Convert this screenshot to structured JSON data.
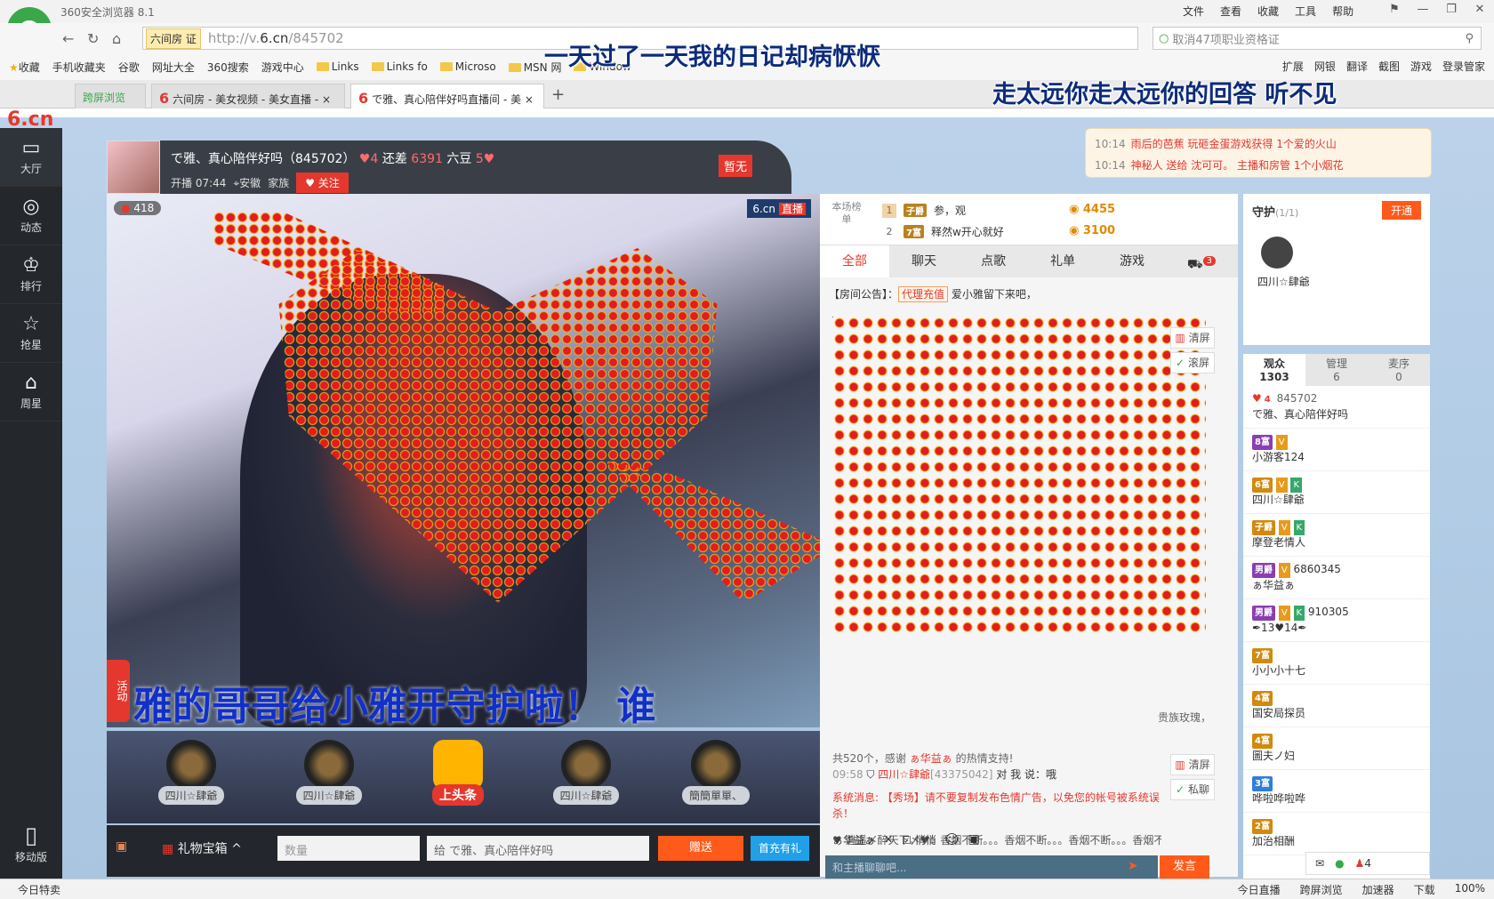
{
  "browser": {
    "title": "360安全浏览器 8.1",
    "menu": [
      "文件",
      "查看",
      "收藏",
      "工具",
      "帮助"
    ],
    "window_controls": [
      "⚑",
      "—",
      "❐",
      "✕"
    ],
    "zone_label": "六间房",
    "zone_badge": "证",
    "url_prefix": "http://v.",
    "url_host": "6.cn",
    "url_path": "/845702",
    "search_text": "取消47项职业资格证",
    "bookmarks": [
      "收藏",
      "手机收藏夹",
      "谷歌",
      "网址大全",
      "360搜索",
      "游戏中心",
      "Links",
      "Links fo",
      "Microso",
      "MSN 网",
      "Window"
    ],
    "right_tools": [
      "扩展",
      "网银",
      "翻译",
      "截图",
      "游戏",
      "登录管家"
    ],
    "tabs": [
      {
        "label": "跨屏浏览"
      },
      {
        "label": "六间房 - 美女视频 - 美女直播 - ×"
      },
      {
        "label": "で雅、真心陪伴好吗直播间 - 美 ×"
      }
    ],
    "overlay_top": "一天过了一天我的日记却病恹恹",
    "overlay_right": "走太远你走太远你的回答  听不见",
    "status_left": "今日特卖",
    "status_right": [
      "今日直播",
      "跨屏浏览",
      "加速器",
      "下载",
      "100%"
    ]
  },
  "site": {
    "logo": "6.cn",
    "nav": [
      {
        "label": "大厅",
        "icon": "tv-icon"
      },
      {
        "label": "动态",
        "icon": "compass-icon"
      },
      {
        "label": "排行",
        "icon": "crown-icon"
      },
      {
        "label": "抢星",
        "icon": "star-icon"
      },
      {
        "label": "周星",
        "icon": "gift-icon"
      }
    ],
    "mobile_label": "移动版"
  },
  "anchor": {
    "room_name": "で雅、真心陪伴好吗（845702）",
    "level": "4",
    "gap_prefix": "还差",
    "gap_amount": "6391",
    "gap_unit": "六豆",
    "next_level": "5",
    "start_label": "开播 07:44",
    "location": "安徽",
    "family": "家族",
    "follow_label": "关注",
    "flag": "暂无",
    "wealth": "418",
    "video_logo": "6.cn",
    "video_logo_tag": "直播",
    "marquee": "雅的哥哥给小雅开守护啦！ 谁",
    "activity_label": "活动"
  },
  "guards": [
    {
      "name": "四川☆肆爺"
    },
    {
      "name": "四川☆肆爺"
    },
    {
      "name": "上头条"
    },
    {
      "name": "四川☆肆爺"
    },
    {
      "name": "簡簡單單、"
    }
  ],
  "giftbar": {
    "box_label": "礼物宝箱",
    "qty_placeholder": "数量",
    "to_label": "给  で雅、真心陪伴好吗",
    "send": "赠送",
    "charge": "首充有礼"
  },
  "notice": [
    {
      "time": "10:14",
      "text": "雨后的芭蕉 玩砸金蛋游戏获得 1个爱的火山"
    },
    {
      "time": "10:14",
      "text": "神秘人 送给 沈可可。 主播和房管 1个小烟花"
    }
  ],
  "rank": {
    "head": "本场榜单",
    "rows": [
      {
        "num": "1",
        "badge": "子爵",
        "name": "参，观",
        "score": "4455"
      },
      {
        "num": "2",
        "badge": "7富",
        "name": "释然w开心就好",
        "score": "3100"
      }
    ]
  },
  "chat": {
    "tabs": [
      "全部",
      "聊天",
      "点歌",
      "礼单",
      "游戏"
    ],
    "tab_badge": "3",
    "public_label": "【房间公告】：",
    "public_link": "代理充值",
    "public_text": "爱小雅留下来吧，",
    "clear": "清屏",
    "scroll": "滚屏",
    "private": "私聊",
    "rose_tag": "贵族玫瑰，",
    "thanks_prefix": "共520个，感谢",
    "thanks_name": "ぁ华益ぁ",
    "thanks_suffix": "的热情支持!",
    "msg_time": "09:58",
    "msg_name": "四川☆肆爺",
    "msg_id": "[43375042]",
    "msg_to": "对 我 说：哦",
    "system": "系统消息: 【秀场】请不要复制发布色情广告，以免您的帐号被系统误杀！",
    "msg3": "♥ 逍遥〆醉天下〆♥：香烟不断。。。香烟不断。。。香烟不断。。。香烟不",
    "target": "ぁ华益ぁ",
    "quiet": "悄悄",
    "input_placeholder": "和主播聊聊吧...",
    "send": "发言"
  },
  "guard_panel": {
    "title": "守护",
    "count": "(1/1)",
    "open": "开通",
    "member": "四川☆肆爺"
  },
  "audience": {
    "tabs": [
      {
        "label": "观众",
        "count": "1303"
      },
      {
        "label": "管理",
        "count": "6"
      },
      {
        "label": "麦序",
        "count": "0"
      }
    ],
    "rows": [
      {
        "level": "4",
        "id": "845702",
        "name": "で雅、真心陪伴好吗"
      },
      {
        "level": "8富",
        "id": "",
        "name": "小游客124"
      },
      {
        "level": "6富",
        "id": "",
        "name": "四川☆肆爺"
      },
      {
        "level": "子爵",
        "id": "",
        "name": "摩登老情人"
      },
      {
        "level": "男爵",
        "id": "6860345",
        "name": "ぁ华益ぁ"
      },
      {
        "level": "男爵",
        "id": "910305",
        "name": "✒13♥14✒"
      },
      {
        "level": "7富",
        "id": "",
        "name": "小小小十七"
      },
      {
        "level": "4富",
        "id": "",
        "name": "国安局探员"
      },
      {
        "level": "4富",
        "id": "",
        "name": "圖夫ノ妇"
      },
      {
        "level": "3富",
        "id": "",
        "name": "哗啦哗啦哗"
      },
      {
        "level": "2富",
        "id": "",
        "name": "加治相酬"
      }
    ],
    "online_count": "4"
  }
}
